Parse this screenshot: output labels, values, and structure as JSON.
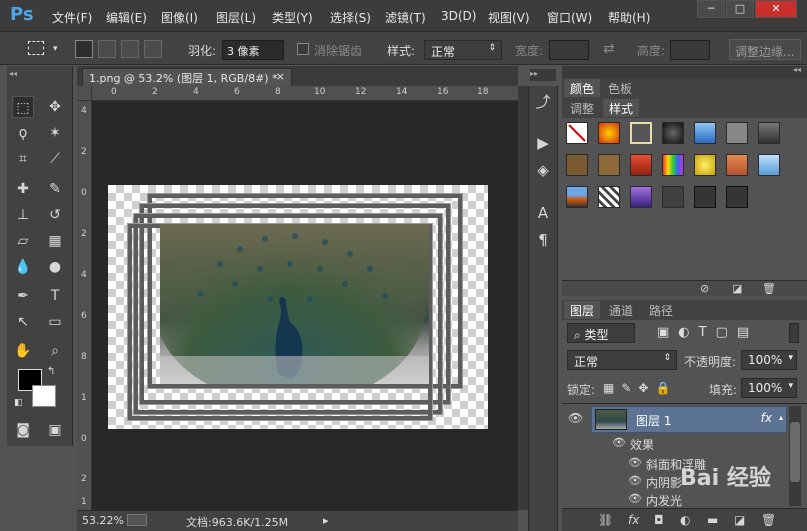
{
  "app": {
    "logo": "Ps"
  },
  "menu": [
    "文件(F)",
    "编辑(E)",
    "图像(I)",
    "图层(L)",
    "类型(Y)",
    "选择(S)",
    "滤镜(T)",
    "3D(D)",
    "视图(V)",
    "窗口(W)",
    "帮助(H)"
  ],
  "window_controls": {
    "minimize": "─",
    "maximize": "□",
    "close": "✕"
  },
  "options": {
    "feather_label": "羽化:",
    "feather_value": "3 像素",
    "antialias_label": "消除锯齿",
    "style_label": "样式:",
    "style_value": "正常",
    "width_label": "宽度:",
    "height_label": "高度:",
    "refine_button": "调整边缘..."
  },
  "document": {
    "tab_title": "1.png @ 53.2% (图层 1, RGB/8#) *",
    "tab_close": "×"
  },
  "ruler": {
    "h_ticks": [
      "0",
      "2",
      "4",
      "6",
      "8",
      "10",
      "12",
      "14",
      "16",
      "18"
    ],
    "v_ticks": [
      "4",
      "2",
      "0",
      "2",
      "4",
      "6",
      "8",
      "1",
      "0",
      "2",
      "1"
    ]
  },
  "status": {
    "zoom": "53.22%",
    "doc_info": "文档:963.6K/1.25M"
  },
  "panels": {
    "top_tabs": [
      "颜色",
      "色板"
    ],
    "second_tabs": [
      "调整",
      "样式"
    ],
    "layers_tabs": [
      "图层",
      "通道",
      "路径"
    ],
    "kind_label": "类型",
    "blend_mode": "正常",
    "opacity_label": "不透明度:",
    "opacity_value": "100%",
    "lock_label": "锁定:",
    "fill_label": "填充:",
    "fill_value": "100%",
    "layer_name": "图层 1",
    "layer_fx": "fx",
    "effects_label": "效果",
    "effects": [
      "斜面和浮雕",
      "内阴影",
      "内发光"
    ]
  },
  "styles_swatches": [
    [
      "#ffffff",
      "#d43010",
      "#555555",
      "#222222",
      "#3b7dc9",
      "#888888",
      "#4a4a4a"
    ],
    [
      "#7a5a30",
      "#8c6a3a",
      "#c83a20",
      "#5a2a9a",
      "#d8c010",
      "#c86a40",
      "#6aa0d8"
    ],
    [
      "#2a5a9a",
      "#8a8a8a",
      "#5a3a9a",
      "#404040",
      "#353535",
      "#353535"
    ]
  ],
  "watermark": "Bai 经验"
}
